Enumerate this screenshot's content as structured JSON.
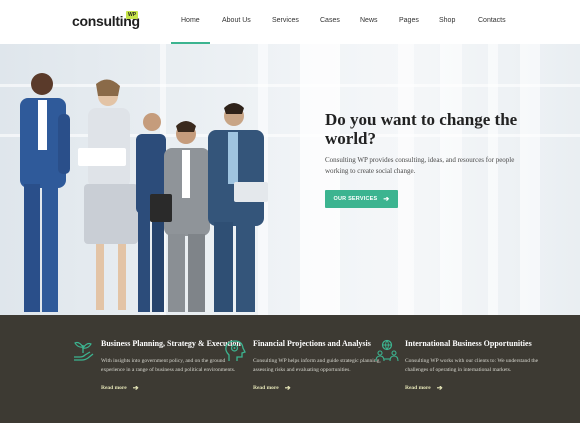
{
  "brand": {
    "name": "consulting",
    "badge": "WP"
  },
  "nav": {
    "items": [
      "Home",
      "About Us",
      "Services",
      "Cases",
      "News",
      "Pages",
      "Shop",
      "Contacts"
    ],
    "active": "Home"
  },
  "hero": {
    "title": "Do you want to change the world?",
    "text": "Consulting WP provides consulting, ideas, and resources for people working to create social change.",
    "button": "OUR SERVICES"
  },
  "features": [
    {
      "icon": "plant-hand-icon",
      "title": "Business Planning, Strategy & Execution",
      "text": "With insights into government policy, and on the ground experience in a range of business and political environments.",
      "link": "Read more"
    },
    {
      "icon": "head-gear-icon",
      "title": "Financial Projections and Analysis",
      "text": "Consulting WP helps inform and guide strategic planning, assessing risks and evaluating opportunities.",
      "link": "Read more"
    },
    {
      "icon": "globe-people-icon",
      "title": "International Business Opportunities",
      "text": "Consulting WP works with our clients to: We understand the challenges of operating in international markets.",
      "link": "Read more"
    }
  ],
  "colors": {
    "accent": "#3cb490",
    "dark": "#3d3a33",
    "badge": "#c8e64b"
  }
}
